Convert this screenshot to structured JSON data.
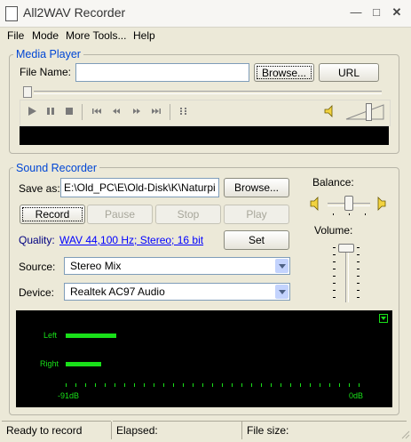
{
  "window": {
    "title": "All2WAV Recorder"
  },
  "menu": [
    "File",
    "Mode",
    "More Tools...",
    "Help"
  ],
  "media_player": {
    "group_label": "Media Player",
    "file_name_label": "File Name:",
    "file_name_value": "",
    "browse_label": "Browse...",
    "url_label": "URL"
  },
  "sound_recorder": {
    "group_label": "Sound Recorder",
    "save_as_label": "Save as:",
    "save_as_value": "E:\\Old_PC\\E\\Old-Disk\\K\\Naturpi",
    "browse_label": "Browse...",
    "record_label": "Record",
    "pause_label": "Pause",
    "stop_label": "Stop",
    "play_label": "Play",
    "quality_label": "Quality:",
    "quality_value": "WAV 44,100 Hz; Stereo; 16 bit",
    "set_label": "Set",
    "source_label": "Source:",
    "source_value": "Stereo Mix",
    "device_label": "Device:",
    "device_value": "Realtek AC97 Audio",
    "balance_label": "Balance:",
    "volume_label": "Volume:"
  },
  "meter": {
    "left_label": "Left",
    "right_label": "Right",
    "min_label": "-91dB",
    "max_label": "0dB"
  },
  "status": {
    "state": "Ready to record",
    "elapsed_label": "Elapsed:",
    "file_size_label": "File size:"
  },
  "icons": {
    "play": "play-icon",
    "pause": "pause-icon",
    "stop": "stop-icon",
    "speaker": "speaker-icon"
  }
}
